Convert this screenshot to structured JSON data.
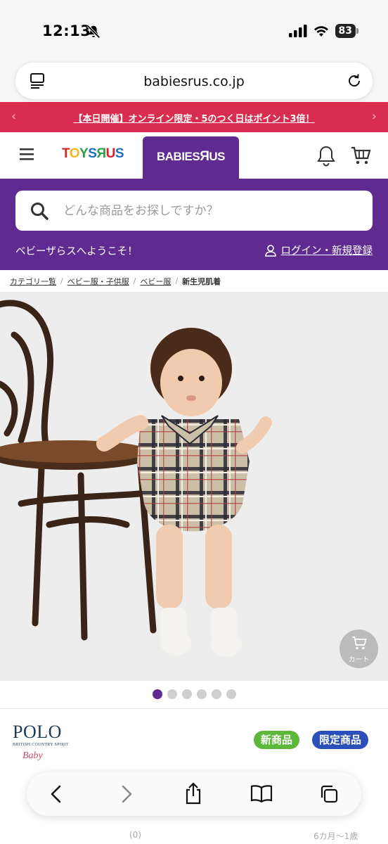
{
  "status": {
    "time": "12:13",
    "battery": "83"
  },
  "browser": {
    "url": "babiesrus.co.jp"
  },
  "promo": {
    "text": "【本日開催】オンライン限定・5のつく日はポイント3倍！",
    "left_arrow": "‹",
    "right_arrow": "›"
  },
  "header": {
    "toys_logo": "TOYS\"R\"US",
    "babies_logo": "BABIES\"R\"US"
  },
  "search": {
    "placeholder": "どんな商品をお探しですか？"
  },
  "account": {
    "welcome": "ベビーザらスへようこそ！",
    "login": "ログイン・新規登録"
  },
  "breadcrumb": {
    "items": [
      "カテゴリ一覧",
      "ベビー服・子供服",
      "ベビー服"
    ],
    "current": "新生児肌着",
    "separator": "/"
  },
  "carousel": {
    "count": 6,
    "active": 0
  },
  "floating_cart": {
    "label": "カート"
  },
  "brand": {
    "name": "POLO",
    "tagline": "BRITISH COUNTRY SPIRIT",
    "sub": "Baby"
  },
  "badges": {
    "new": "新商品",
    "limited": "限定商品"
  },
  "below": {
    "rating_count": "(0)",
    "age": "6カ月〜1歳"
  },
  "colors": {
    "purple": "#5f2b91",
    "promo_red": "#d82d4f",
    "new_green": "#5cb83a",
    "limited_blue": "#2b4fb8"
  }
}
